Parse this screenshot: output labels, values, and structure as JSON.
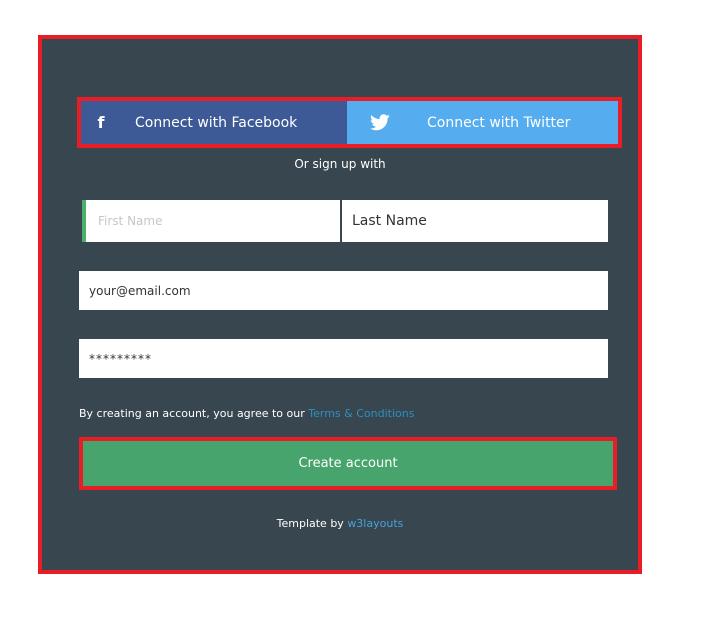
{
  "social": {
    "facebook_icon_glyph": "f",
    "facebook_label": "Connect with Facebook",
    "twitter_icon": "twitter-bird-icon",
    "twitter_label": "Connect with Twitter"
  },
  "or_text": "Or sign up with",
  "form": {
    "first_name_placeholder": "First Name",
    "first_name_value": "",
    "last_name_value": "Last Name",
    "email_value": "your@email.com",
    "password_value": "*********"
  },
  "terms": {
    "prefix": "By creating an account, you agree to our ",
    "link_label": "Terms & Conditions"
  },
  "create_label": "Create account",
  "footer": {
    "prefix": "Template by ",
    "link_label": "w3layouts"
  },
  "colors": {
    "panel": "#37464f",
    "highlight_border": "#e81d26",
    "facebook": "#3d5a96",
    "twitter": "#55acee",
    "create_button": "#46a46c",
    "link": "#2e8fc2",
    "focus_bar": "#4cae6a"
  }
}
